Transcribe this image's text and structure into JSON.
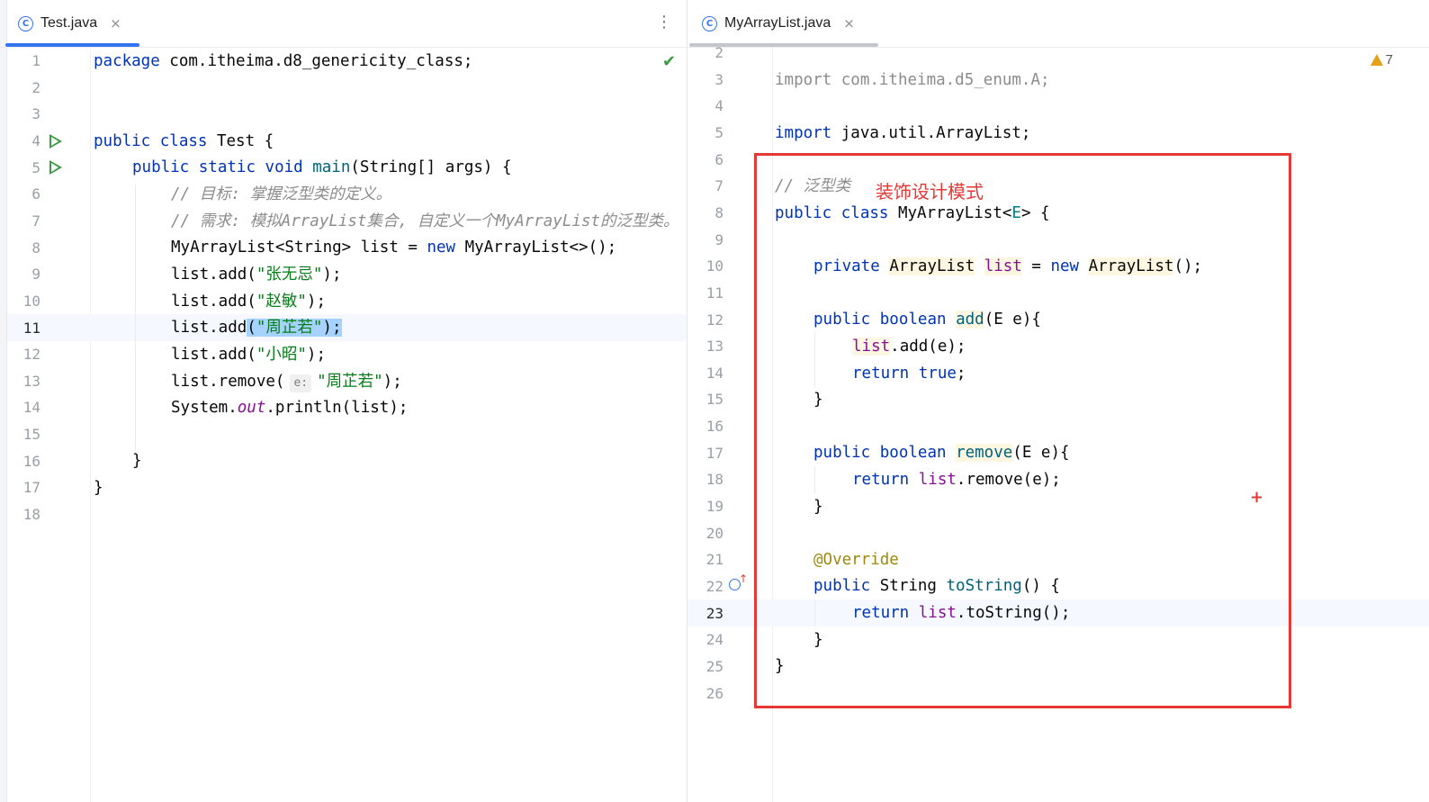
{
  "left": {
    "tab": {
      "label": "Test.java",
      "icon": "class-icon"
    },
    "lines": [
      {
        "n": "1",
        "tokens": [
          [
            "kw",
            "package"
          ],
          [
            "",
            "com.itheima.d8_genericity_class;"
          ]
        ]
      },
      {
        "n": "2",
        "tokens": []
      },
      {
        "n": "3",
        "tokens": []
      },
      {
        "n": "4",
        "tokens": [
          [
            "kw",
            "public"
          ],
          [
            "",
            "class"
          ],
          [
            "",
            "Test {"
          ]
        ]
      },
      {
        "n": "5",
        "tokens": []
      },
      {
        "n": "6",
        "tokens": []
      },
      {
        "n": "7",
        "tokens": []
      },
      {
        "n": "8",
        "tokens": []
      },
      {
        "n": "9",
        "tokens": []
      },
      {
        "n": "10",
        "tokens": []
      },
      {
        "n": "11",
        "tokens": []
      },
      {
        "n": "12",
        "tokens": []
      },
      {
        "n": "13",
        "tokens": []
      },
      {
        "n": "14",
        "tokens": []
      },
      {
        "n": "15",
        "tokens": []
      },
      {
        "n": "16",
        "tokens": []
      },
      {
        "n": "17",
        "tokens": []
      },
      {
        "n": "18",
        "tokens": []
      }
    ],
    "current_line": "11",
    "code": {
      "l1_kw": "package",
      "l1_rest": " com.itheima.d8_genericity_class;",
      "l4_kw1": "public",
      "l4_kw2": "class",
      "l4_rest": " Test {",
      "l5_kw1": "public",
      "l5_kw2": "static",
      "l5_kw3": "void",
      "l5_meth": "main",
      "l5_rest": "(String[] args) {",
      "l6": "// 目标: 掌握泛型类的定义。",
      "l7": "// 需求: 模拟ArrayList集合, 自定义一个MyArrayList的泛型类。",
      "l8_a": "MyArrayList<String> list = ",
      "l8_kw": "new",
      "l8_b": " MyArrayList<>();",
      "l9_a": "list.add(",
      "l9_s": "\"张无忌\"",
      "l9_b": ");",
      "l10_a": "list.add(",
      "l10_s": "\"赵敏\"",
      "l10_b": ");",
      "l11_a": "list.add",
      "l11_sel_a": "(",
      "l11_s": "\"周芷若\"",
      "l11_sel_b": ");",
      "l12_a": "list.add(",
      "l12_s": "\"小昭\"",
      "l12_b": ");",
      "l13_a": "list.remove(",
      "l13_hint": "e:",
      "l13_s": "\"周芷若\"",
      "l13_b": ");",
      "l14_a": "System.",
      "l14_out": "out",
      "l14_b": ".println(list);",
      "l16": "}",
      "l17": "}"
    }
  },
  "right": {
    "tab": {
      "label": "MyArrayList.java",
      "icon": "class-icon"
    },
    "warnings": "7",
    "annotation": "装饰设计模式",
    "current_line": "23",
    "line_numbers": [
      "2",
      "3",
      "4",
      "5",
      "6",
      "7",
      "8",
      "9",
      "10",
      "11",
      "12",
      "13",
      "14",
      "15",
      "16",
      "17",
      "18",
      "19",
      "20",
      "21",
      "22",
      "23",
      "24",
      "25",
      "26"
    ],
    "code": {
      "l3_kw": "import",
      "l3_rest": " com.itheima.d5_enum.A;",
      "l5_kw": "import",
      "l5_rest": " java.util.ArrayList;",
      "l7": "// 泛型类",
      "l8_kw1": "public",
      "l8_kw2": "class",
      "l8_a": " MyArrayList<",
      "l8_e": "E",
      "l8_b": "> {",
      "l10_kw": "private",
      "l10_type": "ArrayList",
      "l10_fld": "list",
      "l10_eq": " = ",
      "l10_new": "new",
      "l10_type2": "ArrayList",
      "l10_end": "();",
      "l12_kw1": "public",
      "l12_kw2": "boolean",
      "l12_meth": "add",
      "l12_a": "(E e){",
      "l13_fld": "list",
      "l13_rest": ".add(e);",
      "l14_kw": "return",
      "l14_val": "true",
      "l14_end": ";",
      "brace": "}",
      "l17_kw1": "public",
      "l17_kw2": "boolean",
      "l17_meth": "remove",
      "l17_a": "(E e){",
      "l18_kw": "return",
      "l18_fld": "list",
      "l18_rest": ".remove(e);",
      "l21": "@Override",
      "l22_kw": "public",
      "l22_a": " String ",
      "l22_meth": "toString",
      "l22_b": "() {",
      "l23_kw": "return",
      "l23_fld": "list",
      "l23_rest": ".toString();"
    }
  }
}
